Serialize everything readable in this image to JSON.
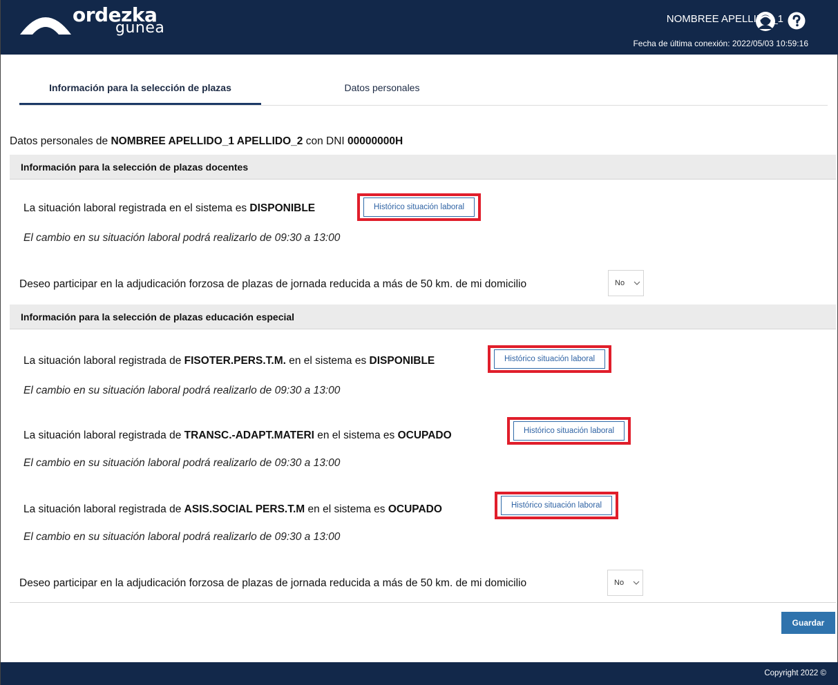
{
  "header": {
    "logo_main": "ordezka",
    "logo_sub": "gunea",
    "user_name": "NOMBREE APELLIDO_1",
    "last_login": "Fecha de última conexión: 2022/05/03 10:59:16"
  },
  "tabs": [
    {
      "label": "Información para la selección de plazas",
      "active": true
    },
    {
      "label": "Datos personales",
      "active": false
    }
  ],
  "intro": {
    "prefix": "Datos personales de ",
    "full_name": "NOMBREE APELLIDO_1 APELLIDO_2",
    "mid": " con DNI ",
    "dni": "00000000H"
  },
  "docentes": {
    "title": "Información para la selección de plazas docentes",
    "status_prefix": "La situación laboral registrada en el sistema es ",
    "status": "DISPONIBLE",
    "history_label": "Histórico situación laboral",
    "note": "El cambio en su situación laboral podrá realizarlo de 09:30 a 13:00",
    "desire_text": "Deseo participar en la adjudicación forzosa de plazas de jornada reducida a más de 50 km. de mi domicilio",
    "desire_value": "No"
  },
  "especial": {
    "title": "Información para la selección de plazas educación especial",
    "items": [
      {
        "prefix": "La situación laboral registrada de ",
        "specialty": "FISOTER.PERS.T.M.",
        "mid": " en el sistema es ",
        "status": "DISPONIBLE",
        "history_label": "Histórico situación laboral",
        "note": "El cambio en su situación laboral podrá realizarlo de 09:30 a 13:00"
      },
      {
        "prefix": "La situación laboral registrada de ",
        "specialty": "TRANSC.-ADAPT.MATERI",
        "mid": " en el sistema es ",
        "status": "OCUPADO",
        "history_label": "Histórico situación laboral",
        "note": "El cambio en su situación laboral podrá realizarlo de 09:30 a 13:00"
      },
      {
        "prefix": "La situación laboral registrada de ",
        "specialty": "ASIS.SOCIAL PERS.T.M",
        "mid": " en el sistema es ",
        "status": "OCUPADO",
        "history_label": "Histórico situación laboral",
        "note": "El cambio en su situación laboral podrá realizarlo de 09:30 a 13:00"
      }
    ],
    "desire_text": "Deseo participar en la adjudicación forzosa de plazas de jornada reducida a más de 50 km. de mi domicilio",
    "desire_value": "No"
  },
  "save_label": "Guardar",
  "footer": {
    "copyright": "Copyright 2022 ©"
  },
  "colors": {
    "header_bg": "#12284a",
    "accent": "#2f73ad",
    "highlight": "#e01e2b"
  }
}
